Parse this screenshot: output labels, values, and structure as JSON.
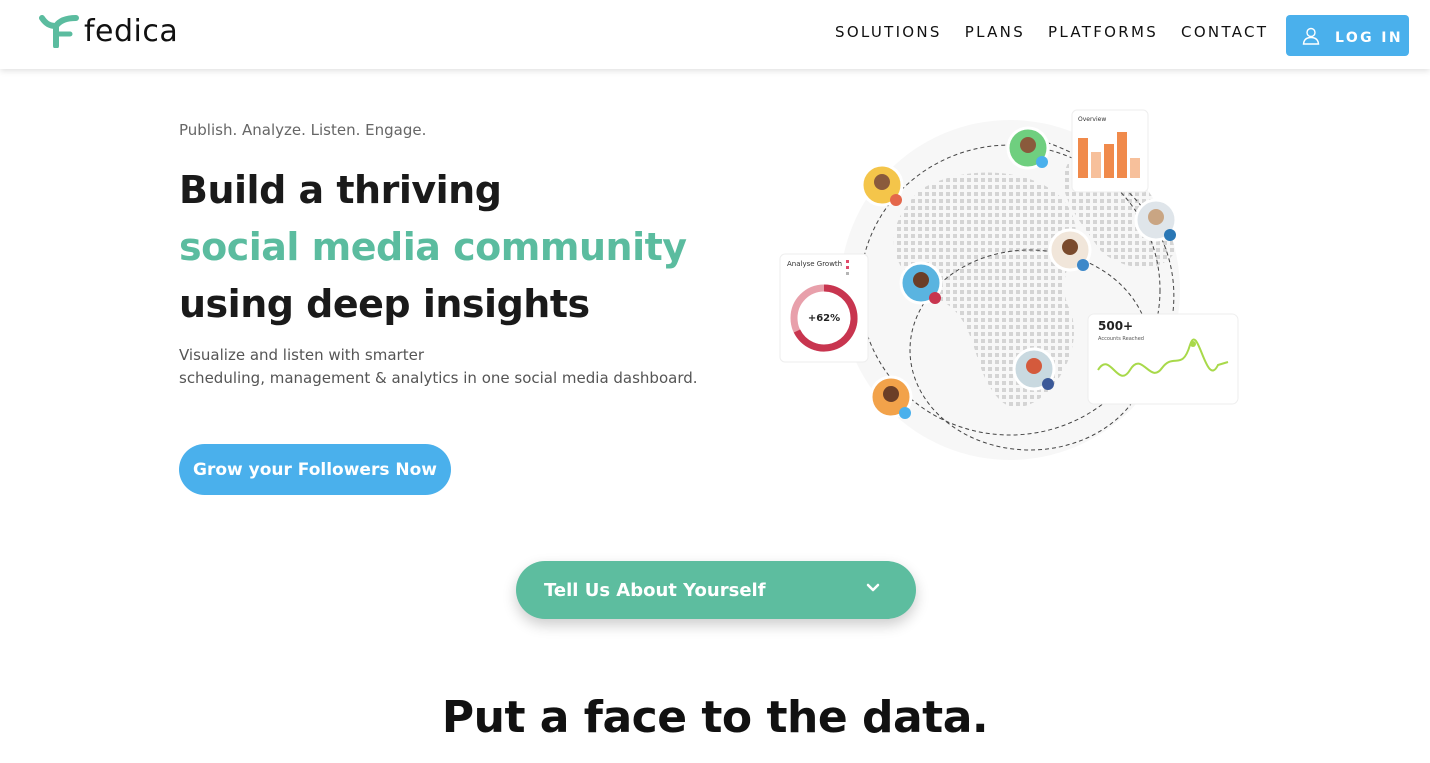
{
  "brand": {
    "name": "fedica",
    "accent": "#5bbc9f",
    "primary": "#4ab0ec"
  },
  "nav": {
    "items": [
      {
        "label": "SOLUTIONS"
      },
      {
        "label": "PLANS"
      },
      {
        "label": "PLATFORMS"
      },
      {
        "label": "CONTACT"
      }
    ],
    "login_label": "LOG IN",
    "login_icon": "user-icon"
  },
  "hero": {
    "tagline": "Publish. Analyze. Listen. Engage.",
    "headline_line1": "Build a thriving",
    "headline_line2": "social media community",
    "headline_line3": "using deep insights",
    "subtext_line1": "Visualize and listen with smarter",
    "subtext_line2": "scheduling, management & analytics in one social media dashboard.",
    "cta_label": "Grow your Followers Now"
  },
  "illustration": {
    "overview_card_title": "Overview",
    "growth_card_title": "Analyse Growth",
    "growth_value": "+62%",
    "reach_value": "500+",
    "reach_label": "Accounts Reached",
    "platform_icons": [
      "twitter-icon",
      "instagram-icon",
      "linkedin-icon",
      "mastodon-icon",
      "pinterest-icon",
      "facebook-icon",
      "twitter-icon"
    ]
  },
  "dropdown": {
    "label": "Tell Us About Yourself",
    "icon": "chevron-down-icon"
  },
  "section": {
    "title": "Put a face to the data."
  }
}
